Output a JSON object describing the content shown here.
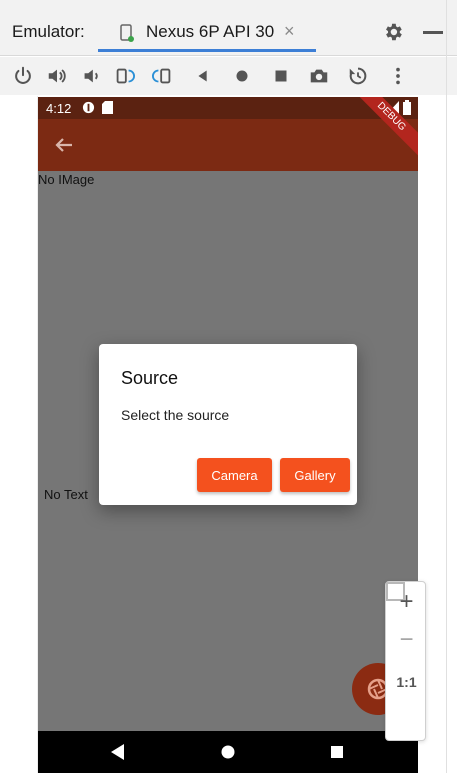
{
  "emulator": {
    "label": "Emulator:",
    "device_tab": "Nexus 6P API 30",
    "close_glyph": "×"
  },
  "toolbar": {
    "icons": [
      "power-icon",
      "volume-up-icon",
      "volume-down-icon",
      "rotate-left-icon",
      "rotate-right-icon",
      "back-icon",
      "home-icon",
      "overview-icon",
      "screenshot-icon",
      "snapshot-icon",
      "more-icon"
    ]
  },
  "device": {
    "status_time": "4:12",
    "debug_banner": "DEBUG",
    "no_image": "No IMage",
    "no_text": "No Text"
  },
  "dialog": {
    "title": "Source",
    "body": "Select the source",
    "camera_label": "Camera",
    "gallery_label": "Gallery"
  },
  "zoom": {
    "zoom_in": "+",
    "zoom_out": "−",
    "actual_size": "1:1"
  },
  "colors": {
    "appbar": "#7c2a13",
    "statusbar": "#5b2211",
    "dialog_button": "#f4511e",
    "tab_accent": "#3d7fd6"
  }
}
